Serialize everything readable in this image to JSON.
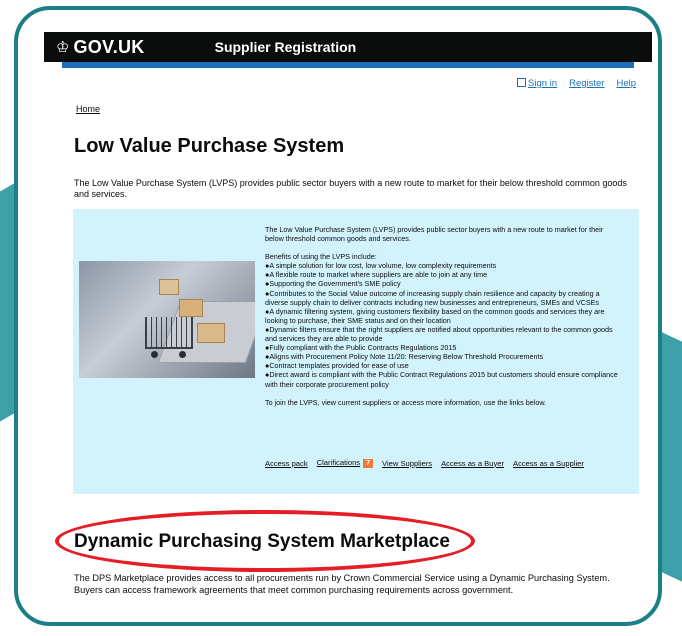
{
  "header": {
    "logo": "GOV.UK",
    "service_name": "Supplier Registration"
  },
  "top_links": {
    "sign_in": "Sign in",
    "register": "Register",
    "help": "Help"
  },
  "breadcrumb": "Home",
  "page_title": "Low Value Purchase System",
  "intro": "The Low Value Purchase System (LVPS) provides public sector buyers with a new route to market for their below threshold common goods and services.",
  "info_box": {
    "intro": "The Low Value Purchase System (LVPS) provides public sector buyers with a new route to market for their below threshold common goods and services.",
    "benefits_heading": "Benefits of using the LVPS include:",
    "benefits": [
      "●A simple solution for low cost, low volume, low complexity requirements",
      "●A flexible route to market where suppliers are able to join at any time",
      "●Supporting the Government's SME policy",
      "●Contributes to the Social Value outcome of increasing supply chain resilience and capacity by creating a diverse supply chain to deliver contracts including new businesses and entrepreneurs, SMEs and VCSEs",
      "●A dynamic filtering system, giving customers flexibility based on the common goods and services they are looking to purchase, their SME status and on their location",
      "●Dynamic filters ensure that the right suppliers are notified about opportunities relevant to the common goods and services they are able to provide",
      "●Fully compliant with the Public Contracts Regulations 2015",
      "●Aligns with Procurement Policy Note 11/20: Reserving Below Threshold Procurements",
      "●Contract templates provided for ease of use",
      "●Direct award is compliant with the Public Contract Regulations 2015 but customers should ensure compliance with their corporate procurement policy"
    ],
    "join_text": "To join the LVPS, view current suppliers or access more information, use the links below.",
    "links": {
      "access_pack": "Access pack",
      "clarifications": "Clarifications",
      "clarifications_badge": "7",
      "view_suppliers": "View Suppliers",
      "access_buyer": "Access as a Buyer",
      "access_supplier": "Access as a Supplier"
    }
  },
  "dps_section": {
    "title": "Dynamic Purchasing System Marketplace",
    "text": "The DPS Marketplace provides access to all procurements run by Crown Commercial Service using a Dynamic Purchasing System. Buyers can access framework agreements that meet common purchasing requirements across government."
  },
  "colors": {
    "frame": "#1b7f86",
    "header_bg": "#0b0c0c",
    "accent_blue": "#1d70b8",
    "info_bg": "#d2f3fb",
    "badge": "#f47738",
    "highlight": "#e31e24"
  }
}
